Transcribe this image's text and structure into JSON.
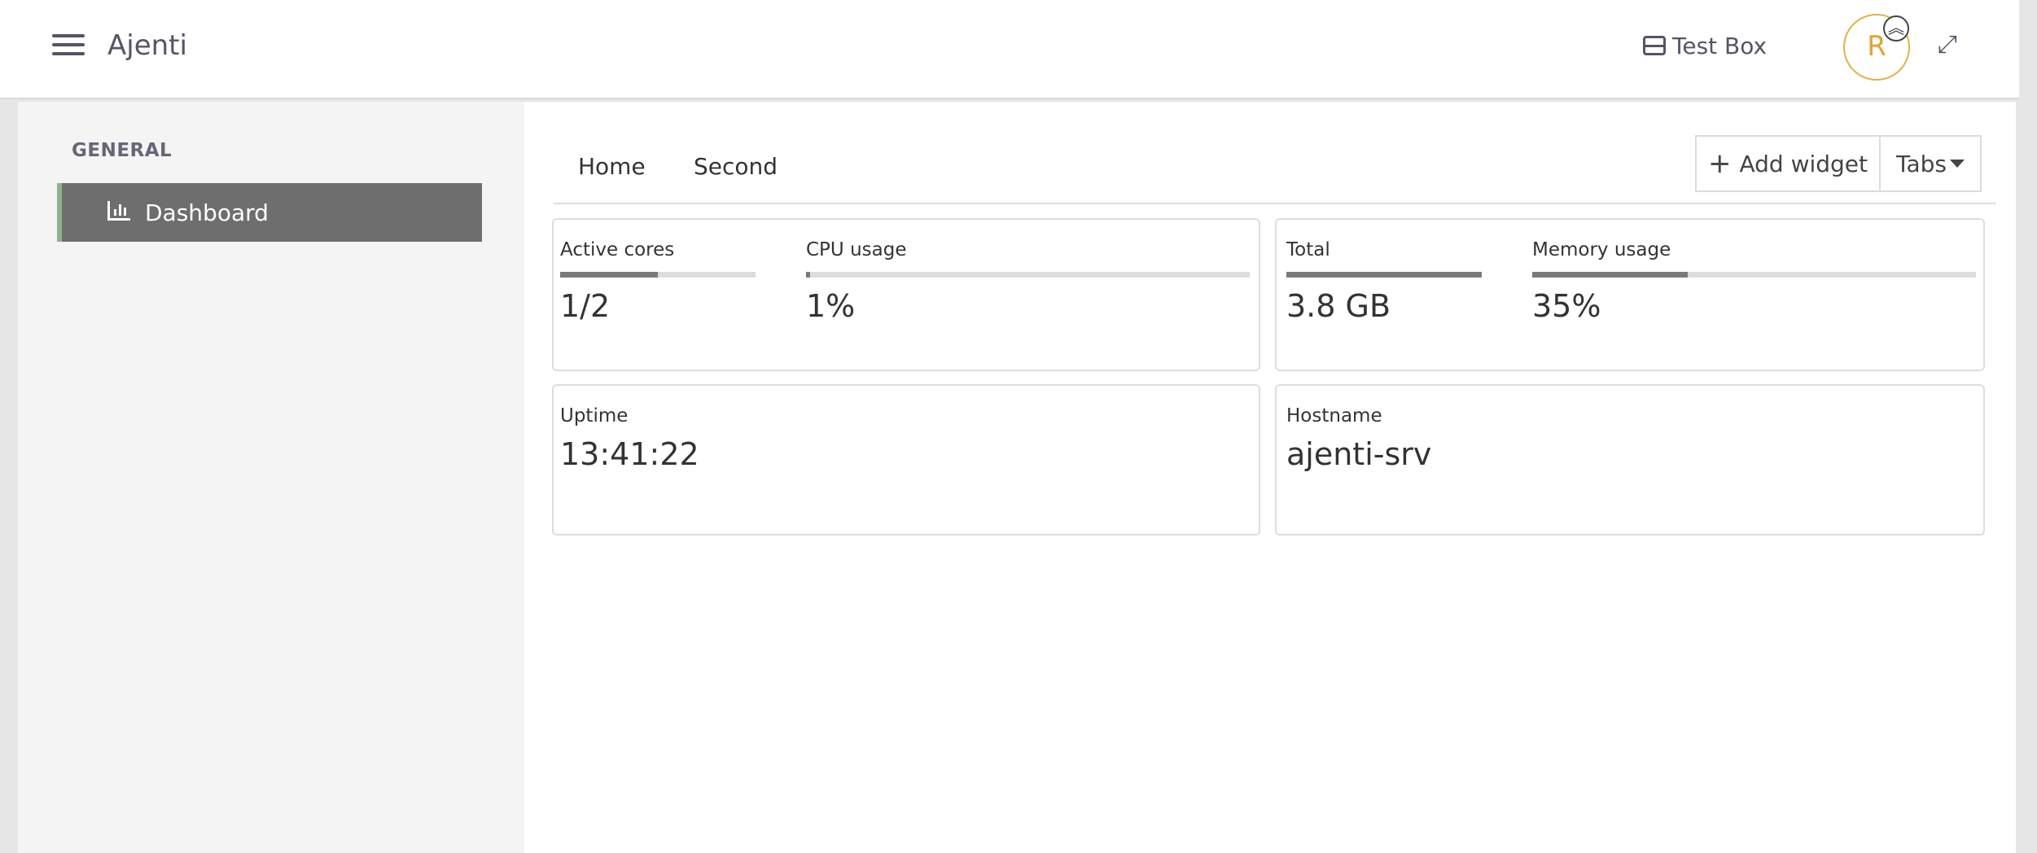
{
  "header": {
    "app_title": "Ajenti",
    "box_name": "Test Box",
    "avatar_letter": "R",
    "menu_icon": "hamburger-icon",
    "box_icon": "server-box-icon",
    "avatar_badge_icon": "double-chevron-up-icon",
    "expand_icon": "expand-icon"
  },
  "sidebar": {
    "section_title": "GENERAL",
    "items": [
      {
        "label": "Dashboard",
        "icon": "bar-chart-icon",
        "active": true
      }
    ]
  },
  "dashboard": {
    "tabs": [
      {
        "label": "Home"
      },
      {
        "label": "Second"
      }
    ],
    "add_widget_label": "Add widget",
    "tabs_menu_label": "Tabs",
    "widgets": {
      "cpu": {
        "active_cores_label": "Active cores",
        "active_cores_value": "1/2",
        "active_cores_fraction": 0.5,
        "cpu_usage_label": "CPU usage",
        "cpu_usage_value": "1%",
        "cpu_usage_fraction": 0.01
      },
      "memory": {
        "total_label": "Total",
        "total_value": "3.8 GB",
        "total_fraction": 1.0,
        "memory_usage_label": "Memory usage",
        "memory_usage_value": "35%",
        "memory_usage_fraction": 0.35
      },
      "uptime": {
        "label": "Uptime",
        "value": "13:41:22"
      },
      "hostname": {
        "label": "Hostname",
        "value": "ajenti-srv"
      }
    }
  },
  "annotations": {
    "header_label": "shell",
    "sidebar_label": "shell",
    "dashboard_label": "dashboard"
  },
  "colors": {
    "shell_overlay": "#8ea3dc",
    "dashboard_overlay": "#9cc49c",
    "accent_avatar": "#e1a33a"
  }
}
